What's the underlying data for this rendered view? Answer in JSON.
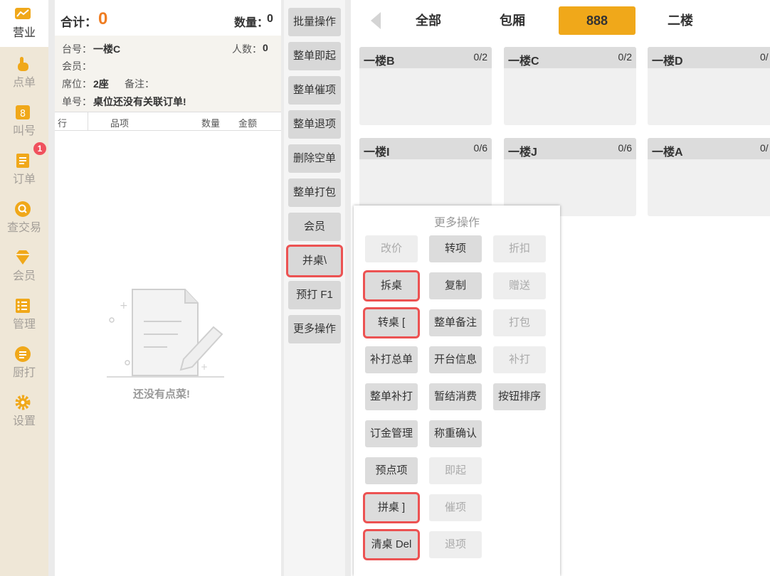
{
  "sidebar": {
    "items": [
      {
        "label": "营业",
        "icon": "chart-icon",
        "active": true
      },
      {
        "label": "点单",
        "icon": "hand-pointer-icon"
      },
      {
        "label": "叫号",
        "icon": "number-call-icon"
      },
      {
        "label": "订单",
        "icon": "order-list-icon",
        "badge": "1"
      },
      {
        "label": "查交易",
        "icon": "search-icon"
      },
      {
        "label": "会员",
        "icon": "diamond-icon"
      },
      {
        "label": "管理",
        "icon": "checklist-icon"
      },
      {
        "label": "厨打",
        "icon": "kitchen-print-icon"
      },
      {
        "label": "设置",
        "icon": "gear-icon"
      }
    ],
    "accent": "#f0a81a"
  },
  "order": {
    "total_label": "合计：",
    "total_value": "0",
    "qty_label": "数量：",
    "qty_value": "0",
    "table_label": "台号：",
    "table_value": "一楼C",
    "people_label": "人数：",
    "people_value": "0",
    "member_label": "会员：",
    "seat_label": "席位：",
    "seat_value": "2座",
    "note_label": "备注：",
    "order_no_label": "单号：",
    "order_no_value": "桌位还没有关联订单!",
    "columns": [
      "行",
      "品项",
      "数量",
      "金额"
    ],
    "empty_text": "还没有点菜!"
  },
  "actions": [
    "批量操作",
    "整单即起",
    "整单催项",
    "整单退项",
    "删除空单",
    "整单打包",
    "会员",
    "并桌\\",
    "预打 F1",
    "更多操作"
  ],
  "tabs": [
    "全部",
    "包厢",
    "888",
    "二楼"
  ],
  "active_tab_color": "#f0a81a",
  "tables": [
    {
      "name": "一楼B",
      "count": "0/2"
    },
    {
      "name": "一楼C",
      "count": "0/2"
    },
    {
      "name": "一楼D",
      "count": "0/"
    },
    {
      "name": "一楼I",
      "count": "0/6"
    },
    {
      "name": "一楼J",
      "count": "0/6"
    },
    {
      "name": "一楼A",
      "count": "0/"
    }
  ],
  "more_ops": {
    "title": "更多操作",
    "buttons": [
      "改价",
      "转项",
      "折扣",
      "拆桌",
      "复制",
      "赠送",
      "转桌 [",
      "整单备注",
      "打包",
      "补打总单",
      "开台信息",
      "补打",
      "整单补打",
      "暂结消费",
      "按钮排序",
      "订金管理",
      "称重确认",
      "预点项",
      "即起",
      "拼桌 ]",
      "催项",
      "清桌 Del",
      "退项"
    ]
  }
}
